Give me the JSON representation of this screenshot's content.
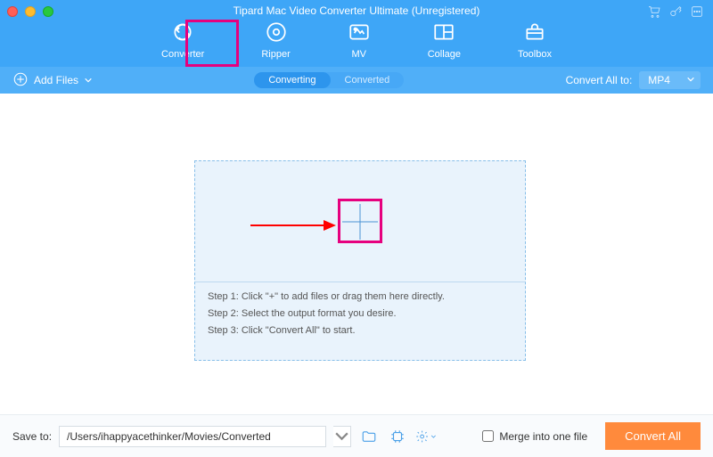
{
  "window": {
    "title": "Tipard Mac Video Converter Ultimate (Unregistered)"
  },
  "tabs": {
    "converter": "Converter",
    "ripper": "Ripper",
    "mv": "MV",
    "collage": "Collage",
    "toolbox": "Toolbox"
  },
  "subbar": {
    "add_files": "Add Files",
    "converting": "Converting",
    "converted": "Converted",
    "convert_all_to": "Convert All to:",
    "format": "MP4"
  },
  "steps": {
    "s1": "Step 1: Click \"+\" to add files or drag them here directly.",
    "s2": "Step 2: Select the output format you desire.",
    "s3": "Step 3: Click \"Convert All\" to start."
  },
  "footer": {
    "save_to_label": "Save to:",
    "save_path": "/Users/ihappyacethinker/Movies/Converted",
    "merge_label": "Merge into one file",
    "convert_all": "Convert All"
  }
}
